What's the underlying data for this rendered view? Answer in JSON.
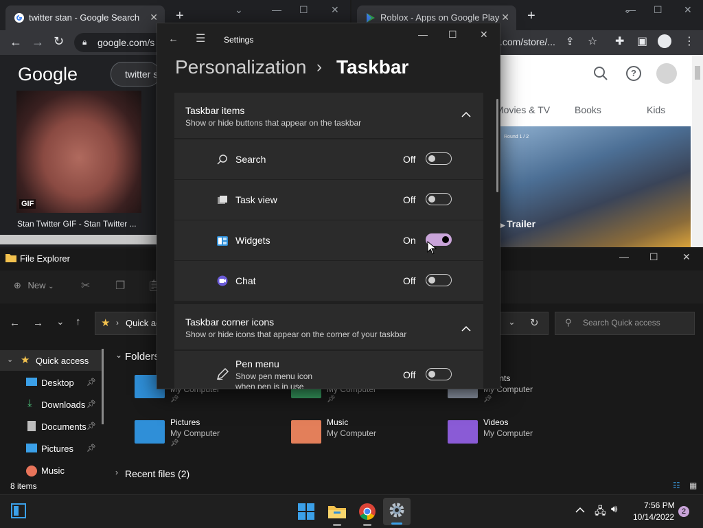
{
  "left_browser": {
    "tab_title": "twitter stan - Google Search",
    "url": "google.com/s",
    "google_logo": "Google",
    "search_query": "twitter s",
    "gif_badge": "GIF",
    "result_caption": "Stan Twitter GIF - Stan Twitter ..."
  },
  "right_browser": {
    "tab_title": "Roblox - Apps on Google Play",
    "url": ".com/store/...",
    "nav_tabs": [
      "Movies & TV",
      "Books",
      "Kids"
    ],
    "trailer_label": "Trailer",
    "video_round": "Round 1 / 2"
  },
  "file_explorer": {
    "title": "File Explorer",
    "new_label": "New",
    "breadcrumb_label": "Quick ac",
    "search_placeholder": "Search Quick access",
    "sidebar": [
      {
        "label": "Quick access",
        "icon": "star-icon"
      },
      {
        "label": "Desktop",
        "icon": "desktop-icon"
      },
      {
        "label": "Downloads",
        "icon": "download-icon"
      },
      {
        "label": "Documents",
        "icon": "document-icon"
      },
      {
        "label": "Pictures",
        "icon": "pictures-icon"
      },
      {
        "label": "Music",
        "icon": "music-icon"
      }
    ],
    "folders_header": "Folders",
    "folders": [
      {
        "name": "",
        "location": "My Computer"
      },
      {
        "name": "",
        "location": "My Computer"
      },
      {
        "name": "uments",
        "location": "My Computer"
      },
      {
        "name": "Pictures",
        "location": "My Computer"
      },
      {
        "name": "Music",
        "location": "My Computer"
      },
      {
        "name": "Videos",
        "location": "My Computer"
      }
    ],
    "recent_header": "Recent files (2)",
    "status": "8 items"
  },
  "settings": {
    "app_title": "Settings",
    "breadcrumb_parent": "Personalization",
    "breadcrumb_separator": "›",
    "breadcrumb_current": "Taskbar",
    "section1": {
      "title": "Taskbar items",
      "subtitle": "Show or hide buttons that appear on the taskbar",
      "items": [
        {
          "label": "Search",
          "state": "Off",
          "icon": "search-icon"
        },
        {
          "label": "Task view",
          "state": "Off",
          "icon": "task-view-icon"
        },
        {
          "label": "Widgets",
          "state": "On",
          "icon": "widgets-icon"
        },
        {
          "label": "Chat",
          "state": "Off",
          "icon": "chat-icon"
        }
      ]
    },
    "section2": {
      "title": "Taskbar corner icons",
      "subtitle": "Show or hide icons that appear on the corner of your taskbar",
      "item": {
        "label": "Pen menu",
        "description_1": "Show pen menu icon",
        "description_2": "when pen is in use",
        "state": "Off",
        "icon": "pen-icon"
      }
    }
  },
  "taskbar": {
    "time": "7:56 PM",
    "date": "10/14/2022",
    "notification_count": "2"
  },
  "colors": {
    "toggle_on": "#c9a4d9",
    "settings_bg": "#202020",
    "card_bg": "#2b2b2b"
  }
}
